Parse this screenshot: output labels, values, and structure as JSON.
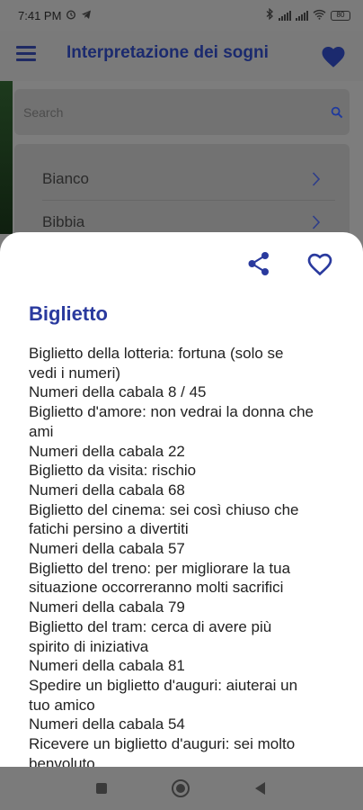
{
  "status_bar": {
    "time": "7:41 PM",
    "battery_level": "80",
    "icons": [
      "alarm-icon",
      "telegram-icon",
      "bluetooth-icon",
      "signal-icon",
      "signal-icon",
      "wifi-icon",
      "battery-icon"
    ]
  },
  "app_bar": {
    "title": "Interpretazione dei sogni",
    "menu_icon": "hamburger-menu-icon",
    "favorite_icon": "heart-filled-icon"
  },
  "search": {
    "placeholder": "Search",
    "icon": "search-icon"
  },
  "list": {
    "items": [
      {
        "label": "Bianco"
      },
      {
        "label": "Bibbia"
      }
    ]
  },
  "sheet": {
    "share_icon": "share-icon",
    "favorite_icon": "heart-outline-icon",
    "title": "Biglietto",
    "lines": [
      "Biglietto della lotteria: fortuna (solo se",
      "vedi i numeri)",
      "Numeri della cabala 8 / 45",
      "Biglietto d'amore: non vedrai la donna che",
      "ami",
      "Numeri della cabala 22",
      "Biglietto da visita: rischio",
      "Numeri della cabala 68",
      "Biglietto del cinema: sei così chiuso che",
      "fatichi persino a divertiti",
      "Numeri della cabala 57",
      "Biglietto del treno: per migliorare la tua",
      "situazione occorreranno molti sacrifici",
      "Numeri della cabala 79",
      "Biglietto del tram: cerca di avere più",
      "spirito di iniziativa",
      "Numeri della cabala 81",
      "Spedire un biglietto d'auguri: aiuterai un",
      "tuo amico",
      "Numeri della cabala 54",
      "Ricevere un biglietto d'auguri: sei molto",
      "benvoluto"
    ]
  },
  "nav_bar": {
    "icons": [
      "recents-square-icon",
      "home-circle-icon",
      "back-triangle-icon"
    ]
  },
  "colors": {
    "accent": "#2a3a9e",
    "title": "#1b2a6e",
    "scrim": "#7b7b7b"
  }
}
